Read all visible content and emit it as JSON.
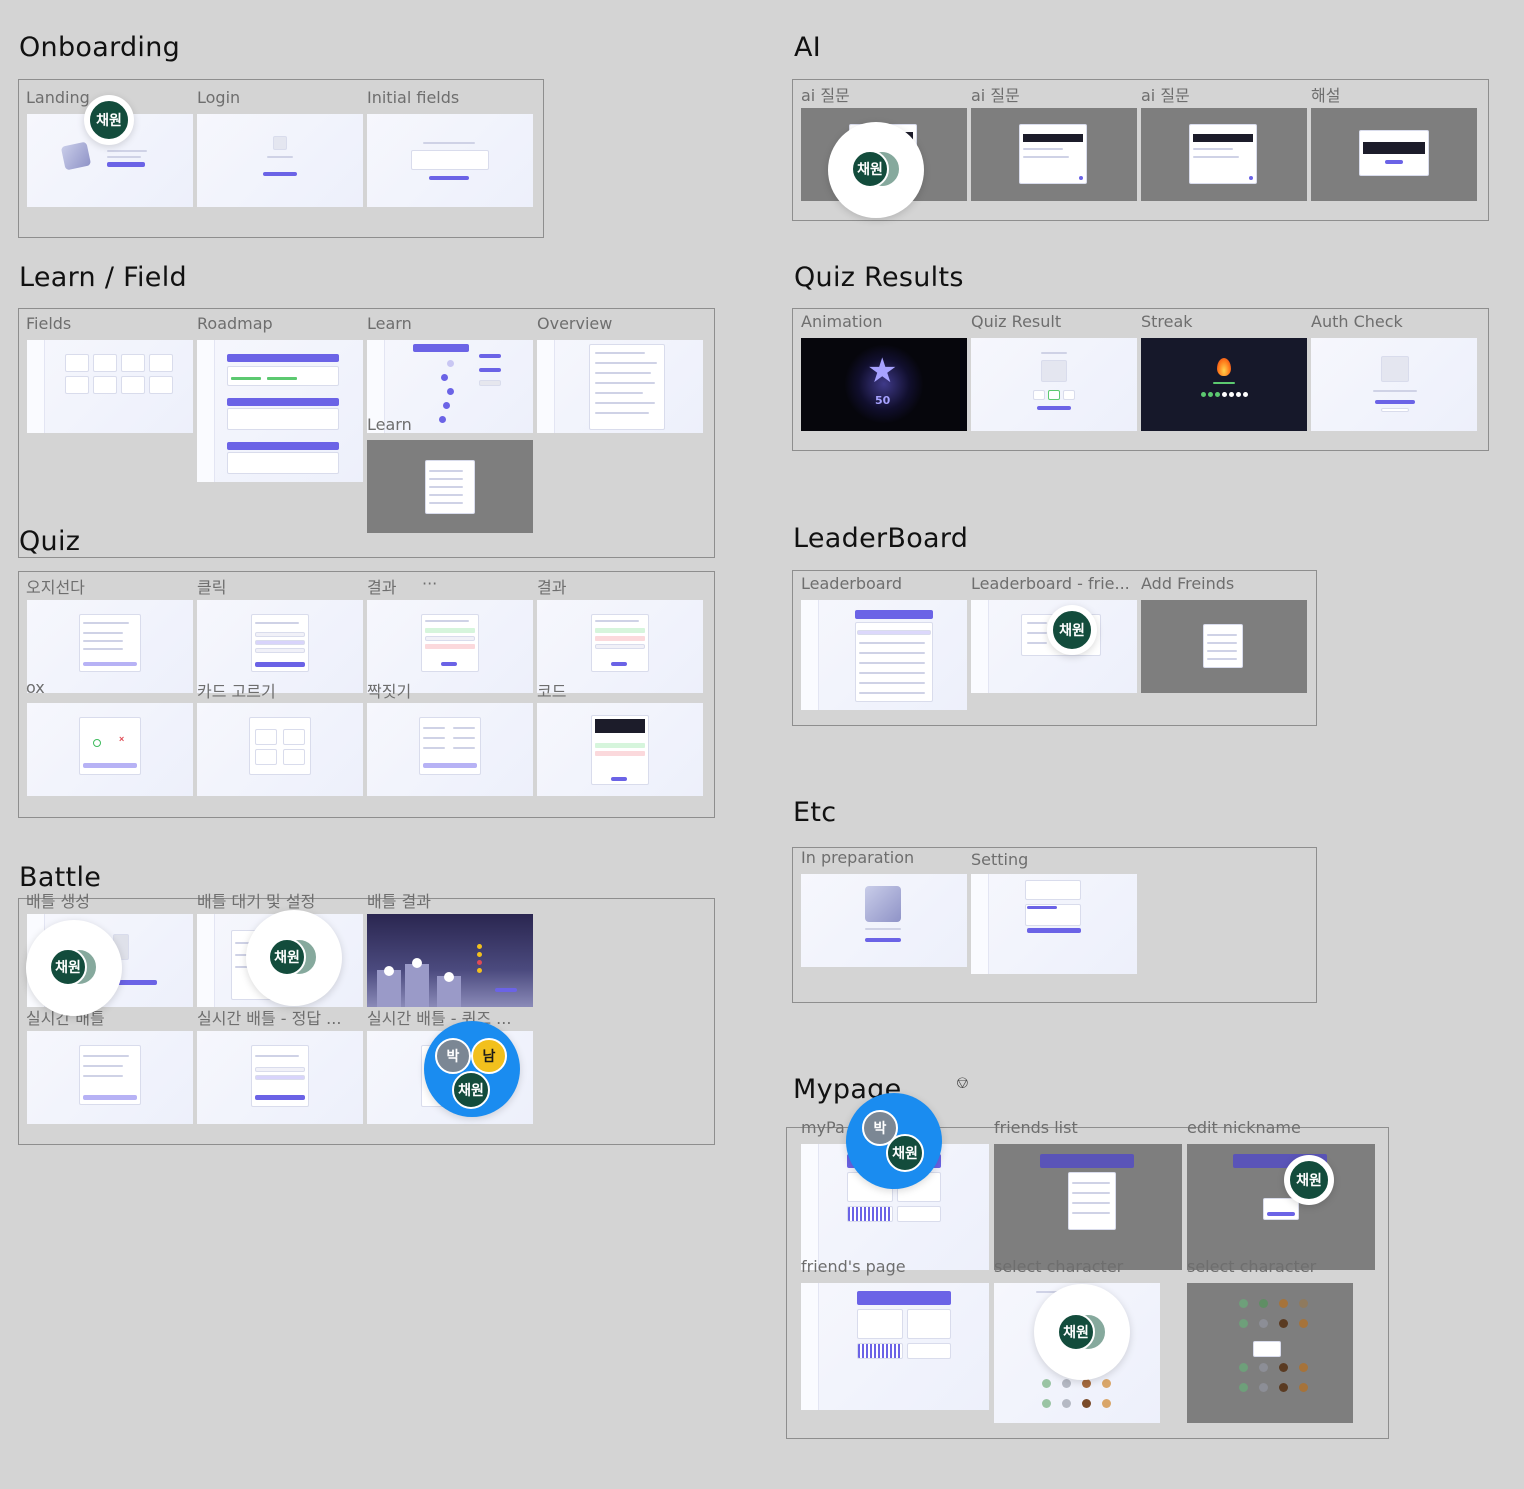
{
  "sections": {
    "onboarding": {
      "title": "Onboarding",
      "frames": [
        "Landing",
        "Login",
        "Initial fields"
      ]
    },
    "learn_field": {
      "title": "Learn / Field",
      "frames": [
        "Fields",
        "Roadmap",
        "Learn",
        "Overview",
        "Learn"
      ]
    },
    "quiz": {
      "title": "Quiz",
      "frames": [
        "오지선다",
        "클릭",
        "결과",
        "결과",
        "ox",
        "카드 고르기",
        "짝짓기",
        "코드"
      ],
      "more_label": "···"
    },
    "battle": {
      "title": "Battle",
      "frames": [
        "배틀 생성",
        "배틀 대기 및 설정",
        "배틀 결과",
        "실시간 배틀",
        "실시간 배틀 - 정답 ...",
        "실시간 배틀 - 퀴즈 ..."
      ]
    },
    "ai": {
      "title": "AI",
      "frames": [
        "ai 질문",
        "ai 질문",
        "ai 질문",
        "해설"
      ]
    },
    "quiz_results": {
      "title": "Quiz Results",
      "frames": [
        "Animation",
        "Quiz Result",
        "Streak",
        "Auth Check"
      ],
      "animation_score": "50"
    },
    "leaderboard": {
      "title": "LeaderBoard",
      "frames": [
        "Leaderboard",
        "Leaderboard - frie...",
        "Add Freinds"
      ]
    },
    "etc": {
      "title": "Etc",
      "frames": [
        "In preparation",
        "Setting"
      ]
    },
    "mypage": {
      "title": "Mypage",
      "frames": [
        "myPa",
        "friends list",
        "edit nickname",
        "friend's page",
        "select character",
        "select character"
      ]
    }
  },
  "collaborators": {
    "chaewon": "채원",
    "park": "박",
    "nam": "남"
  },
  "colors": {
    "canvas": "#d4d4d4",
    "avatar_green": "#134c3c",
    "avatar_blue_halo": "#1a8cf0",
    "accent_purple": "#6b63e6"
  },
  "icons": {
    "component": "component-icon"
  }
}
